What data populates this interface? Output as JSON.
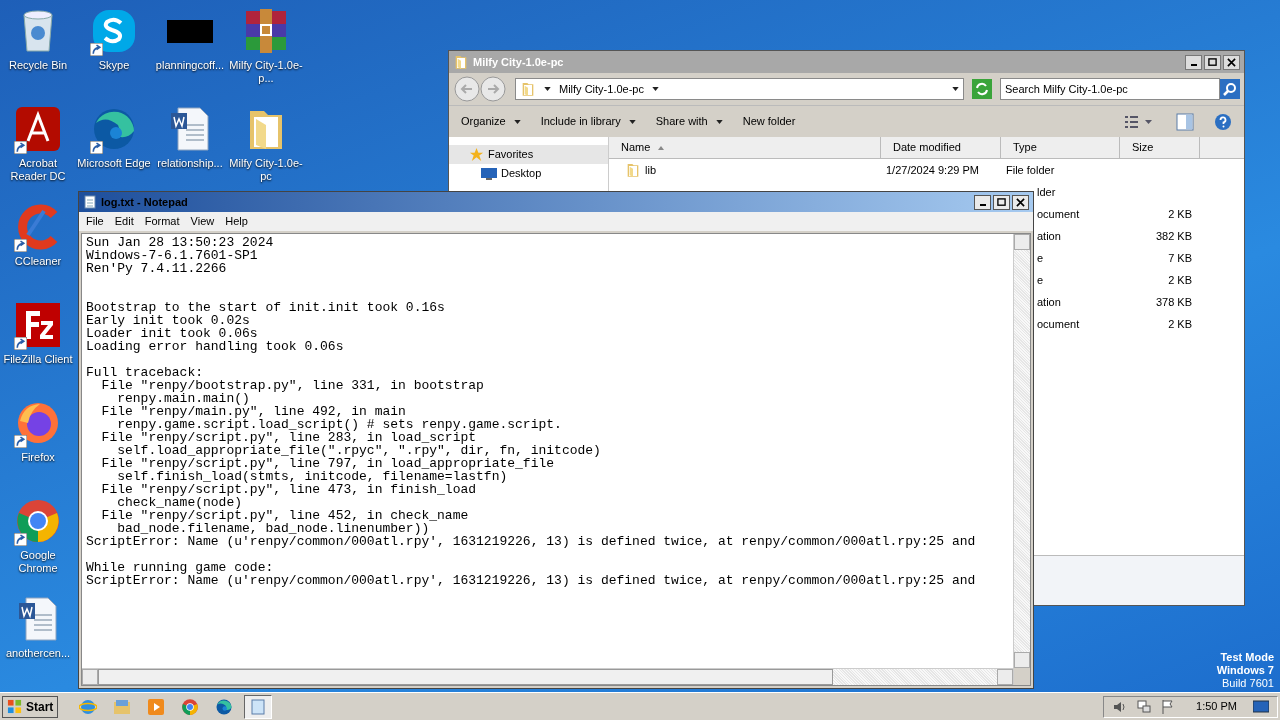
{
  "desktop_icons": [
    {
      "label": "Recycle Bin",
      "kind": "recycle",
      "shortcut": false
    },
    {
      "label": "Acrobat Reader DC",
      "kind": "pdf",
      "shortcut": true
    },
    {
      "label": "CCleaner",
      "kind": "ccleaner",
      "shortcut": true
    },
    {
      "label": "FileZilla Client",
      "kind": "filezilla",
      "shortcut": true
    },
    {
      "label": "Firefox",
      "kind": "firefox",
      "shortcut": true
    },
    {
      "label": "Google Chrome",
      "kind": "chrome",
      "shortcut": true
    },
    {
      "label": "anothercen...",
      "kind": "word",
      "shortcut": false
    },
    {
      "label": "Skype",
      "kind": "skype",
      "shortcut": true
    },
    {
      "label": "Microsoft Edge",
      "kind": "edge",
      "shortcut": true
    },
    {
      "label": "planningcoff...",
      "kind": "blank",
      "shortcut": false
    },
    {
      "label": "relationship...",
      "kind": "word",
      "shortcut": false
    },
    {
      "label": "Milfy City-1.0e-p...",
      "kind": "archive",
      "shortcut": false
    },
    {
      "label": "Milfy City-1.0e-pc",
      "kind": "folder",
      "shortcut": false
    }
  ],
  "explorer": {
    "title": "Milfy City-1.0e-pc",
    "active": false,
    "breadcrumb": "Milfy City-1.0e-pc",
    "search": {
      "placeholder": "Search Milfy City-1.0e-pc"
    },
    "toolbar": [
      {
        "label": "Organize",
        "dropdown": true
      },
      {
        "label": "Include in library",
        "dropdown": true
      },
      {
        "label": "Share with",
        "dropdown": true
      },
      {
        "label": "New folder",
        "dropdown": false
      }
    ],
    "nav": [
      {
        "label": "Favorites",
        "kind": "star"
      },
      {
        "label": "Desktop",
        "kind": "desktop"
      }
    ],
    "columns": [
      "Name",
      "Date modified",
      "Type",
      "Size"
    ],
    "rows": [
      {
        "name": "lib",
        "date": "1/27/2024 9:29 PM",
        "type": "File folder",
        "size": "",
        "covered": false
      },
      {
        "type": "lder",
        "size": "",
        "covered": true
      },
      {
        "type": "ocument",
        "size": "2 KB",
        "covered": true
      },
      {
        "type": "ation",
        "size": "382 KB",
        "covered": true
      },
      {
        "type": "e",
        "size": "7 KB",
        "covered": true
      },
      {
        "type": "e",
        "size": "2 KB",
        "covered": true
      },
      {
        "type": "ation",
        "size": "378 KB",
        "covered": true
      },
      {
        "type": "ocument",
        "size": "2 KB",
        "covered": true
      }
    ]
  },
  "notepad": {
    "title": "log.txt - Notepad",
    "active": true,
    "menu": [
      "File",
      "Edit",
      "Format",
      "View",
      "Help"
    ],
    "paragraphs": [
      {
        "kind": "lead",
        "lines": [
          "Sun Jan 28 13:50:23 2024",
          "Windows-7-6.1.7601-SP1",
          "Ren'Py 7.4.11.2266"
        ]
      },
      {
        "kind": "spaced",
        "lines": [
          "Bootstrap to the start of init.init took 0.16s",
          "Early init took 0.02s",
          "Loader init took 0.06s",
          "Loading error handling took 0.06s"
        ]
      },
      {
        "kind": "block",
        "lines": [
          "Full traceback:",
          "  File \"renpy/bootstrap.py\", line 331, in bootstrap",
          "    renpy.main.main()",
          "  File \"renpy/main.py\", line 492, in main",
          "    renpy.game.script.load_script() # sets renpy.game.script.",
          "  File \"renpy/script.py\", line 283, in load_script",
          "    self.load_appropriate_file(\".rpyc\", \".rpy\", dir, fn, initcode)",
          "  File \"renpy/script.py\", line 797, in load_appropriate_file",
          "    self.finish_load(stmts, initcode, filename=lastfn)",
          "  File \"renpy/script.py\", line 473, in finish_load",
          "    check_name(node)",
          "  File \"renpy/script.py\", line 452, in check_name",
          "    bad_node.filename, bad_node.linenumber))",
          "ScriptError: Name (u'renpy/common/000atl.rpy', 1631219226, 13) is defined twice, at renpy/common/000atl.rpy:25 and"
        ]
      },
      {
        "kind": "block",
        "lines": [
          "While running game code:",
          "ScriptError: Name (u'renpy/common/000atl.rpy', 1631219226, 13) is defined twice, at renpy/common/000atl.rpy:25 and"
        ]
      }
    ]
  },
  "watermark_os": [
    "Test Mode",
    "Windows 7",
    "Build 7601"
  ],
  "taskbar": {
    "start": "Start",
    "apps": [
      {
        "kind": "ie",
        "selected": false
      },
      {
        "kind": "explorer",
        "selected": false
      },
      {
        "kind": "media",
        "selected": false
      },
      {
        "kind": "chrome",
        "selected": false
      },
      {
        "kind": "edge",
        "selected": false
      },
      {
        "kind": "notepad",
        "selected": true
      }
    ],
    "clock": "1:50 PM"
  }
}
